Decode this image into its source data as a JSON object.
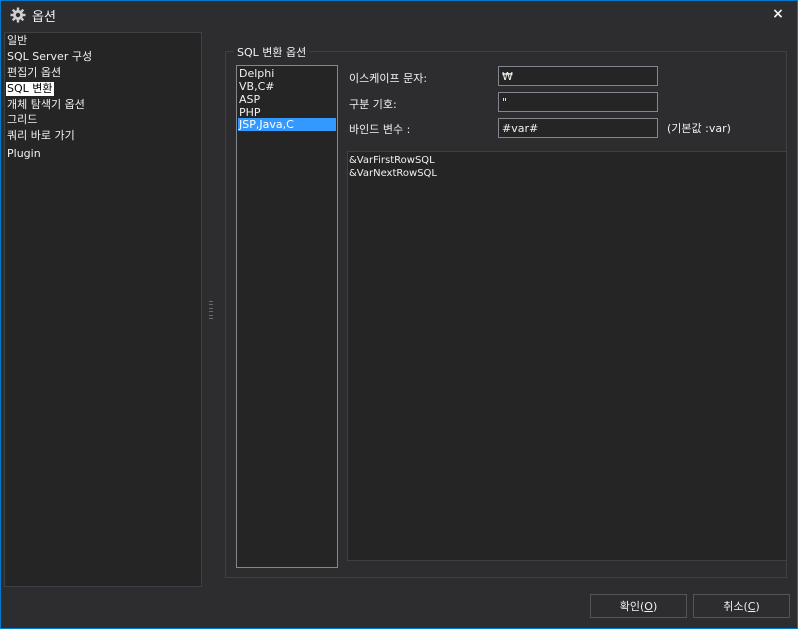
{
  "window": {
    "title": "옵션",
    "title_icon": "gear-icon",
    "close_glyph": "×"
  },
  "colors": {
    "accent_border": "#007acc",
    "selection": "#3399ff",
    "background": "#2d2d30",
    "panel": "#252526"
  },
  "nav": {
    "items": [
      {
        "label": "일반"
      },
      {
        "label": "SQL Server 구성"
      },
      {
        "label": "편집기 옵션"
      },
      {
        "label": "SQL 변환",
        "selected": true
      },
      {
        "label": "개체 탐색기 옵션"
      },
      {
        "label": "그리드"
      },
      {
        "label": "쿼리 바로 가기"
      },
      {
        "label": "Plugin"
      }
    ]
  },
  "group": {
    "title": "SQL 변환 옵션"
  },
  "languages": {
    "items": [
      {
        "label": "Delphi"
      },
      {
        "label": "VB,C#"
      },
      {
        "label": "ASP"
      },
      {
        "label": "PHP"
      },
      {
        "label": "JSP,Java,C",
        "selected": true
      }
    ]
  },
  "fields": {
    "escape": {
      "label": "이스케이프 문자:",
      "value": "₩"
    },
    "delimiter": {
      "label": "구분 기호:",
      "value": "\""
    },
    "bind": {
      "label": "바인드 변수 :",
      "value": "#var#",
      "hint": "(기본값 :var)"
    }
  },
  "textarea": {
    "lines": [
      "&VarFirstRowSQL",
      "&VarNextRowSQL"
    ]
  },
  "buttons": {
    "ok": {
      "text": "확인(",
      "mnemonic": "O",
      "close": ")"
    },
    "cancel": {
      "text": "취소(",
      "mnemonic": "C",
      "close": ")"
    }
  }
}
